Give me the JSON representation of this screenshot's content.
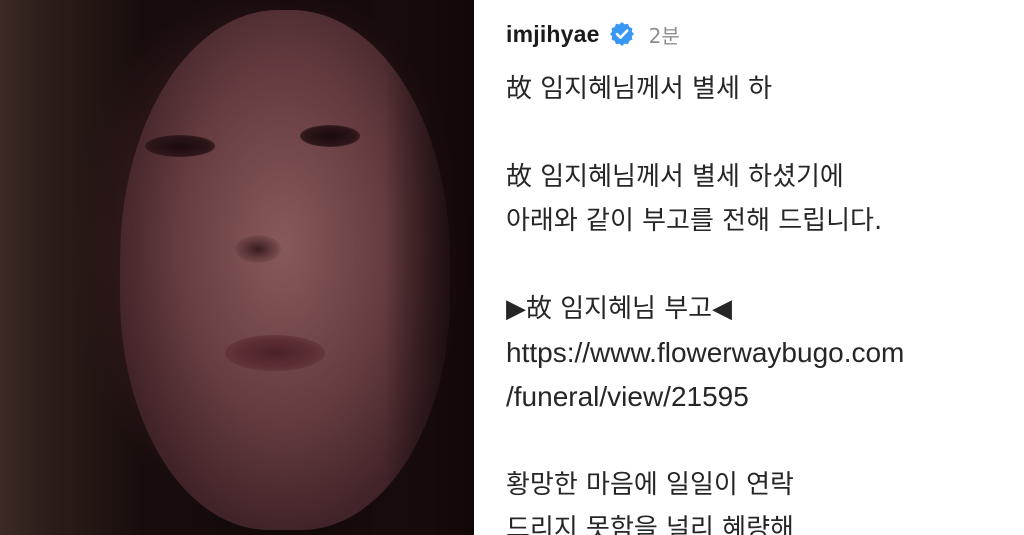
{
  "post": {
    "username": "imjihyae",
    "time": "2분",
    "verified_icon": "verified-badge-icon",
    "verified_color": "#3897f0",
    "lines": [
      "故 임지혜님께서 별세 하",
      "",
      "故 임지혜님께서 별세 하셨기에",
      "아래와 같이 부고를 전해 드립니다.",
      "",
      "▶故 임지혜님 부고◀",
      "https://www.flowerwaybugo.com",
      "/funeral/view/21595",
      "",
      "황망한 마음에 일일이 연락",
      "드리지 못함을 널리 혜량해"
    ]
  }
}
